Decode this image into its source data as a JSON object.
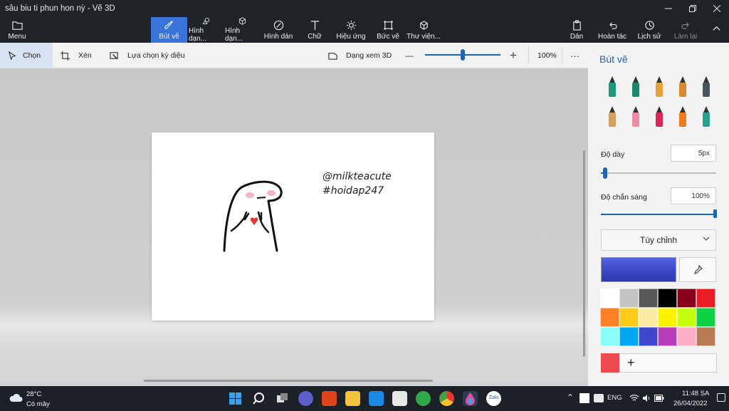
{
  "window": {
    "title": "sâu biu ti phun hon nỳ - Vẽ 3D",
    "controls": [
      "minimize",
      "maximize",
      "close"
    ]
  },
  "ribbon": {
    "menu_label": "Menu",
    "tools": [
      {
        "label": "Bút vẽ",
        "icon": "brush-icon",
        "active": true
      },
      {
        "label": "Hình dạn...",
        "icon": "2d-shapes-icon"
      },
      {
        "label": "Hình dạn...",
        "icon": "3d-shapes-icon"
      },
      {
        "label": "Hình dán",
        "icon": "stickers-icon"
      },
      {
        "label": "Chữ",
        "icon": "text-icon"
      },
      {
        "label": "Hiệu ứng",
        "icon": "effects-icon"
      },
      {
        "label": "Bức vẽ",
        "icon": "canvas-icon"
      },
      {
        "label": "Thư viện...",
        "icon": "3d-library-icon"
      }
    ],
    "right": {
      "paste": "Dán",
      "undo": "Hoàn tác",
      "history": "Lịch sử",
      "redo": "Làm lại"
    }
  },
  "toolbar": {
    "select": "Chọn",
    "crop": "Xén",
    "magic_select": "Lựa chọn kỳ diệu",
    "view_3d": "Dạng xem 3D",
    "zoom_minus": "—",
    "zoom_plus": "+",
    "zoom_value": "100%",
    "zoom_fraction": 0.5,
    "more": "···"
  },
  "canvas": {
    "text_line1": "@milkteacute",
    "text_line2": "#hoidap247"
  },
  "panel": {
    "title": "Bút vẽ",
    "brushes": [
      {
        "name": "marker-brush",
        "color": "#1a9a7a"
      },
      {
        "name": "calligraphy-pen-brush",
        "color": "#1a8a6a"
      },
      {
        "name": "oil-brush",
        "color": "#e8a23c"
      },
      {
        "name": "watercolor-brush",
        "color": "#d88a2c"
      },
      {
        "name": "pixel-pen-brush",
        "color": "#4a5560"
      },
      {
        "name": "pencil-brush",
        "color": "#d8a060"
      },
      {
        "name": "eraser-brush",
        "color": "#f08aa0"
      },
      {
        "name": "crayon-brush",
        "color": "#d8285a"
      },
      {
        "name": "spray-can-brush",
        "color": "#f07a20"
      },
      {
        "name": "fill-bucket-brush",
        "color": "#2aa090"
      }
    ],
    "thickness_label": "Độ dày",
    "thickness_value": "5px",
    "thickness_fraction": 0.04,
    "opacity_label": "Độ chắn sáng",
    "opacity_value": "100%",
    "opacity_fraction": 1.0,
    "dropdown_label": "Tùy chỉnh",
    "current_color": "#3b46c8",
    "palette": [
      "#ffffff",
      "#c3c3c3",
      "#585858",
      "#000000",
      "#88001b",
      "#ec1c24",
      "#ff7f27",
      "#ffca18",
      "#fdeca6",
      "#fff200",
      "#c4ff0e",
      "#0ed145",
      "#8cfffb",
      "#00a8f3",
      "#3f48cc",
      "#b83dba",
      "#ffaec8",
      "#b97a56"
    ],
    "custom_color": "#ef4a4f",
    "add_label": "+"
  },
  "taskbar": {
    "weather_temp": "28°C",
    "weather_desc": "Có mây",
    "apps": [
      "start-icon",
      "search-icon",
      "task-view-icon",
      "chat-icon",
      "office-icon",
      "file-explorer-icon",
      "mail-icon",
      "store-icon",
      "browser-icon",
      "chrome-icon",
      "paint-3d-icon",
      "zalo-icon"
    ],
    "language": "ENG",
    "time": "11:48 SA",
    "date": "26/04/2022"
  }
}
